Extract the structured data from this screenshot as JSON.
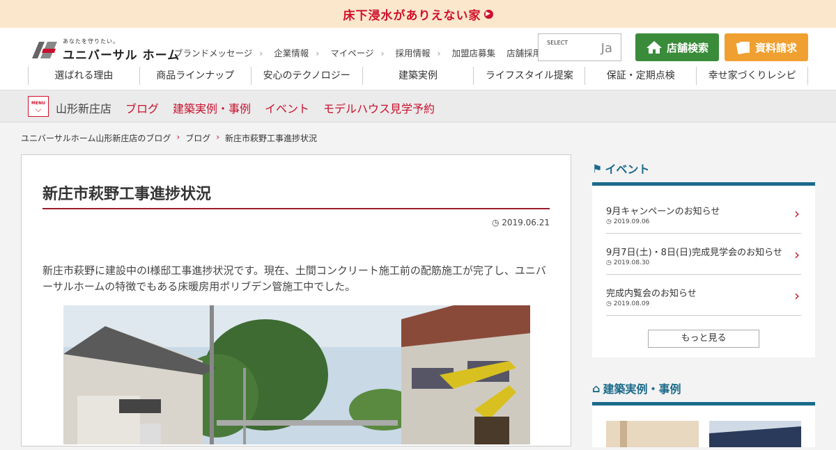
{
  "topbar": {
    "text": "床下浸水がありえない家"
  },
  "header": {
    "logo_tagline": "あなたを守りたい。",
    "logo_name": "ユニバーサル ホーム",
    "util_nav": [
      "ブランドメッセージ",
      "企業情報",
      "マイページ",
      "採用情報",
      "加盟店募集",
      "店舗採用情報"
    ],
    "select_label": "SELECT",
    "select_value": "Ja",
    "store_search": "店舗検索",
    "doc_request": "資料請求",
    "main_nav": [
      "選ばれる理由",
      "商品ラインナップ",
      "安心のテクノロジー",
      "建築実例",
      "ライフスタイル提案",
      "保証・定期点検",
      "幸せ家づくりレシピ"
    ]
  },
  "subbar": {
    "menu_label": "MENU",
    "store_name": "山形新庄店",
    "links": [
      "ブログ",
      "建築実例・事例",
      "イベント",
      "モデルハウス見学予約"
    ]
  },
  "breadcrumb": [
    "ユニバーサルホーム山形新庄店のブログ",
    "ブログ",
    "新庄市萩野工事進捗状況"
  ],
  "article": {
    "title": "新庄市萩野工事進捗状況",
    "date": "2019.06.21",
    "body": "新庄市萩野に建設中のI様邸工事進捗状況です。現在、土間コンクリート施工前の配筋施工が完了し、ユニバーサルホームの特徴でもある床暖房用ポリブデン管施工中でした。"
  },
  "sidebar": {
    "events_heading": "イベント",
    "events": [
      {
        "title": "9月キャンペーンのお知らせ",
        "date": "2019.09.06"
      },
      {
        "title": "9月7日(土)・8日(日)完成見学会のお知らせ",
        "date": "2019.08.30"
      },
      {
        "title": "完成内覧会のお知らせ",
        "date": "2019.08.09"
      }
    ],
    "more": "もっと見る",
    "cases_heading": "建築実例・事例"
  },
  "colors": {
    "brand_red": "#c8102e",
    "green": "#3a8c3a",
    "orange": "#f0a030",
    "teal": "#1a6a8a"
  }
}
